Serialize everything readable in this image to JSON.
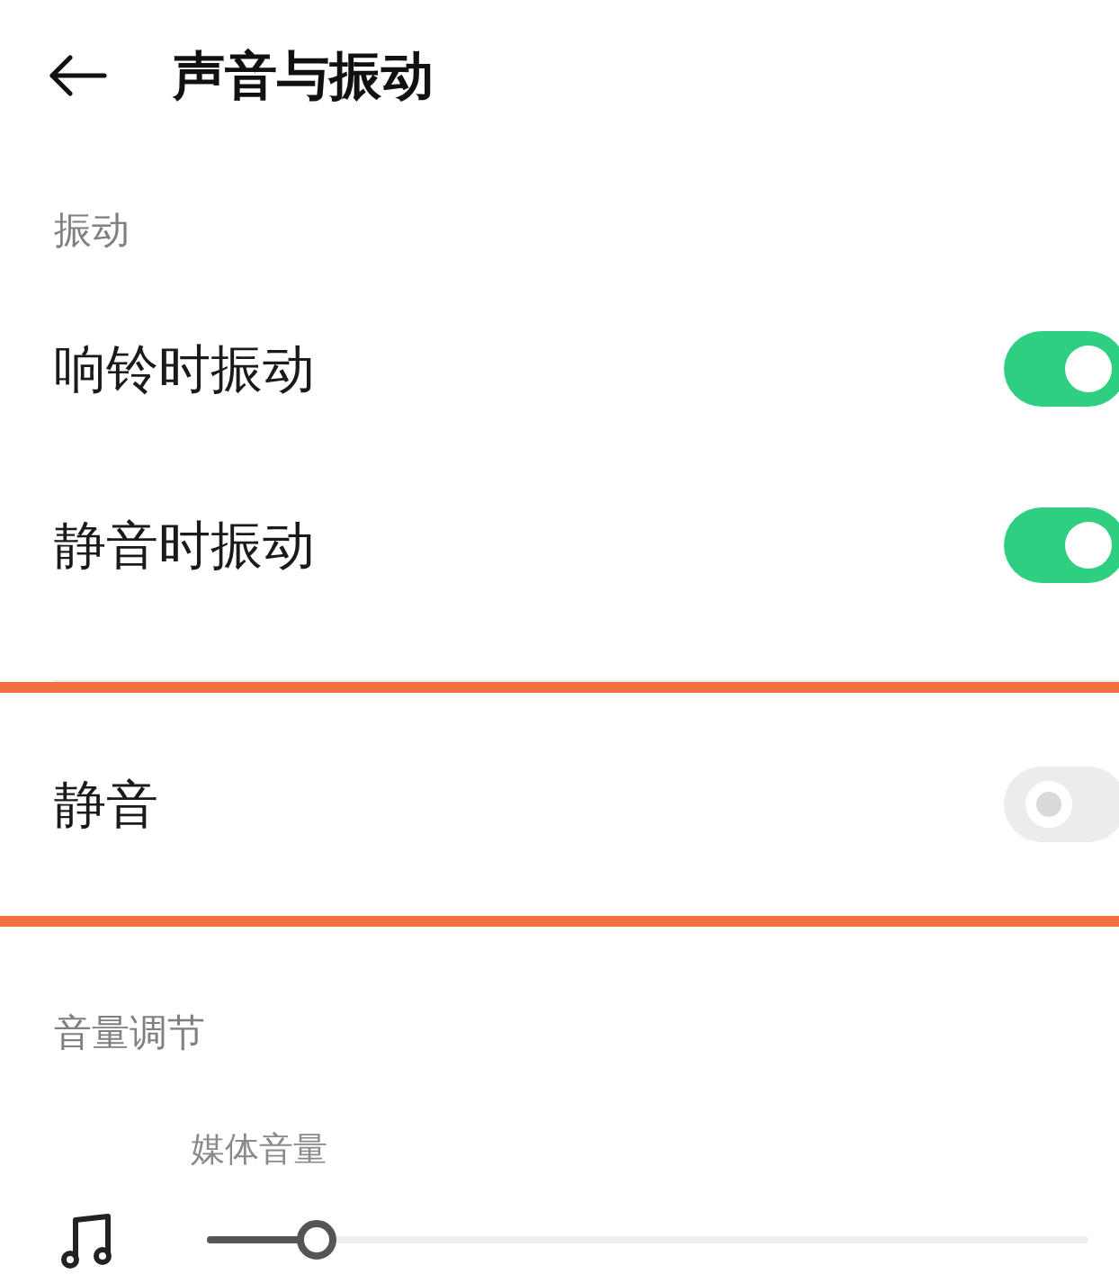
{
  "header": {
    "title": "声音与振动"
  },
  "sections": [
    {
      "label": "振动",
      "items": [
        {
          "kind": "toggle",
          "label": "响铃时振动",
          "on": true,
          "highlighted": false
        },
        {
          "kind": "toggle",
          "label": "静音时振动",
          "on": true,
          "highlighted": false
        }
      ]
    },
    {
      "items": [
        {
          "kind": "toggle",
          "label": "静音",
          "on": false,
          "highlighted": true
        }
      ]
    },
    {
      "label": "音量调节",
      "items": [
        {
          "kind": "slider",
          "label": "媒体音量",
          "level": 0.125,
          "highlighted": false
        }
      ]
    }
  ]
}
